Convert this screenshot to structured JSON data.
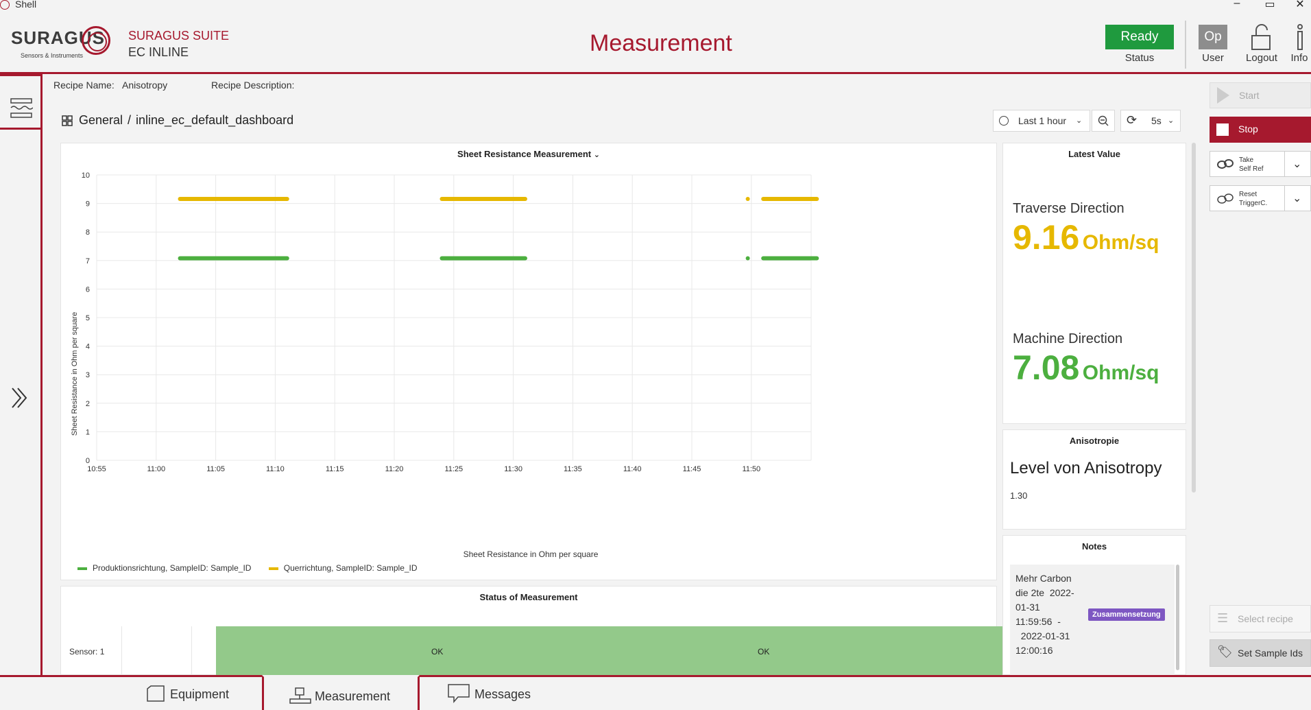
{
  "window": {
    "title": "Shell",
    "minimize": "–",
    "restore": "▭",
    "close": "✕"
  },
  "header": {
    "logo_name": "SURAGUS",
    "logo_sub": "Sensors & Instruments",
    "suite_line1": "SURAGUS SUITE",
    "suite_line2": "EC INLINE",
    "page_title": "Measurement",
    "status_value": "Ready",
    "status_label": "Status",
    "user_badge": "Op",
    "user_label": "User",
    "logout_label": "Logout",
    "info_label": "Info",
    "colors": {
      "brand": "#a6192e",
      "ready": "#1f9a3e",
      "user_badge": "#8d8d8d"
    }
  },
  "recipe": {
    "name_label": "Recipe Name:",
    "name_value": "Anisotropy",
    "description_label": "Recipe Description:"
  },
  "dashboard": {
    "breadcrumb_root": "General",
    "breadcrumb_sep": "/",
    "breadcrumb_leaf": "inline_ec_default_dashboard",
    "time_range": "Last 1 hour",
    "refresh_interval": "5s"
  },
  "chart_panel": {
    "title": "Sheet Resistance Measurement",
    "ylabel": "Sheet Resistance in Ohm per square",
    "xlabel": "Sheet Resistance in Ohm per square",
    "legend": [
      "Produktionsrichtung, SampleID: Sample_ID",
      "Querrichtung, SampleID: Sample_ID"
    ]
  },
  "chart_data": {
    "type": "scatter",
    "title": "Sheet Resistance Measurement",
    "xlabel": "Sheet Resistance in Ohm per square",
    "ylabel": "Sheet Resistance in Ohm per square",
    "x_ticks": [
      "10:55",
      "11:00",
      "11:05",
      "11:10",
      "11:15",
      "11:20",
      "11:25",
      "11:30",
      "11:35",
      "11:40",
      "11:45",
      "11:50"
    ],
    "y_ticks": [
      0,
      1,
      2,
      3,
      4,
      5,
      6,
      7,
      8,
      9,
      10
    ],
    "ylim": [
      0,
      10
    ],
    "grid": true,
    "legend_position": "bottom-left",
    "series": [
      {
        "name": "Produktionsrichtung, SampleID: Sample_ID",
        "color": "#4caf3f",
        "segments": [
          {
            "from": "11:02",
            "to": "11:11",
            "value": 7.08
          },
          {
            "from": "11:24",
            "to": "11:31",
            "value": 7.08
          },
          {
            "from": "11:49.7",
            "to": "11:49.7",
            "value": 7.08
          },
          {
            "from": "11:51",
            "to": "11:55.5",
            "value": 7.08
          }
        ]
      },
      {
        "name": "Querrichtung, SampleID: Sample_ID",
        "color": "#e6b800",
        "segments": [
          {
            "from": "11:02",
            "to": "11:11",
            "value": 9.16
          },
          {
            "from": "11:24",
            "to": "11:31",
            "value": 9.16
          },
          {
            "from": "11:49.7",
            "to": "11:49.7",
            "value": 9.16
          },
          {
            "from": "11:51",
            "to": "11:55.5",
            "value": 9.16
          }
        ]
      }
    ]
  },
  "latest_value": {
    "title": "Latest Value",
    "traverse_label": "Traverse Direction",
    "traverse_value": "9.16",
    "traverse_unit": "Ohm/sq",
    "machine_label": "Machine Direction",
    "machine_value": "7.08",
    "machine_unit": "Ohm/sq",
    "colors": {
      "traverse": "#e6b800",
      "machine": "#4caf3f"
    }
  },
  "anisotropy": {
    "title": "Anisotropie",
    "heading": "Level von Anisotropy",
    "value": "1.30"
  },
  "status_panel": {
    "title": "Status of Measurement",
    "row_label": "Sensor: 1",
    "ok1": "OK",
    "ok2": "OK"
  },
  "notes": {
    "title": "Notes",
    "lines": [
      "Mehr Carbon",
      "die 2te",
      "2022-",
      "01-31",
      "11:59:56",
      "-",
      "2022-01-31",
      "12:00:16"
    ],
    "tag": "Zusammensetzung",
    "tag_color": "#7e57c2"
  },
  "actions": {
    "start": "Start",
    "stop": "Stop",
    "take_line1": "Take",
    "take_line2": "Self Ref",
    "reset_line1": "Reset",
    "reset_line2": "TriggerC.",
    "select_recipe": "Select recipe",
    "set_sample_ids": "Set Sample Ids"
  },
  "bottom_tabs": [
    "Equipment",
    "Measurement",
    "Messages"
  ]
}
